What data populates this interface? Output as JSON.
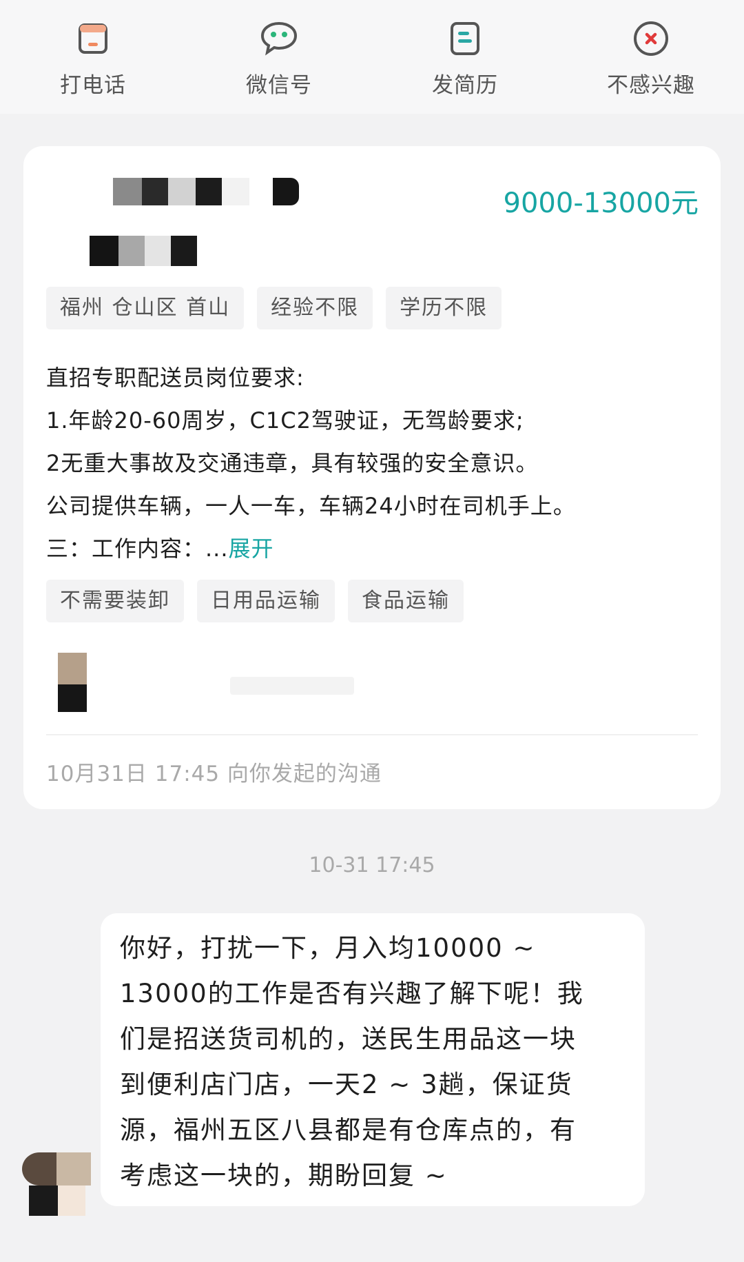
{
  "actions": [
    {
      "label": "打电话",
      "icon": "phone-call-icon"
    },
    {
      "label": "微信号",
      "icon": "wechat-icon"
    },
    {
      "label": "发简历",
      "icon": "resume-icon"
    },
    {
      "label": "不感兴趣",
      "icon": "not-interested-icon"
    }
  ],
  "job": {
    "salary": "9000-13000元",
    "location_tags": [
      "福州 仓山区 首山",
      "经验不限",
      "学历不限"
    ],
    "description_lines": [
      "直招专职配送员岗位要求:",
      "1.年龄20-60周岁，C1C2驾驶证，无驾龄要求;",
      "2无重大事故及交通违章，具有较强的安全意识。",
      "公司提供车辆，一人一车，车辆24小时在司机手上。"
    ],
    "last_line_prefix": "三：工作内容：...",
    "expand_label": "展开",
    "attribute_tags": [
      "不需要装卸",
      "日用品运输",
      "食品运输"
    ],
    "initiated_text": "10月31日 17:45 向你发起的沟通"
  },
  "chat": {
    "timestamp": "10-31 17:45",
    "message_lines": [
      "你好，打扰一下，月入均10000 ~",
      "13000的工作是否有兴趣了解下呢！我",
      "们是招送货司机的，送民生用品这一块",
      "到便利店门店，一天2 ~ 3趟，保证货",
      "源，福州五区八县都是有仓库点的，有",
      "考虑这一块的，期盼回复 ~"
    ]
  },
  "colors": {
    "accent": "#17a5a3",
    "not_interested": "#e03a3a",
    "phone": "#f0a080",
    "wechat": "#2bb57a",
    "resume": "#2aa7a4"
  }
}
